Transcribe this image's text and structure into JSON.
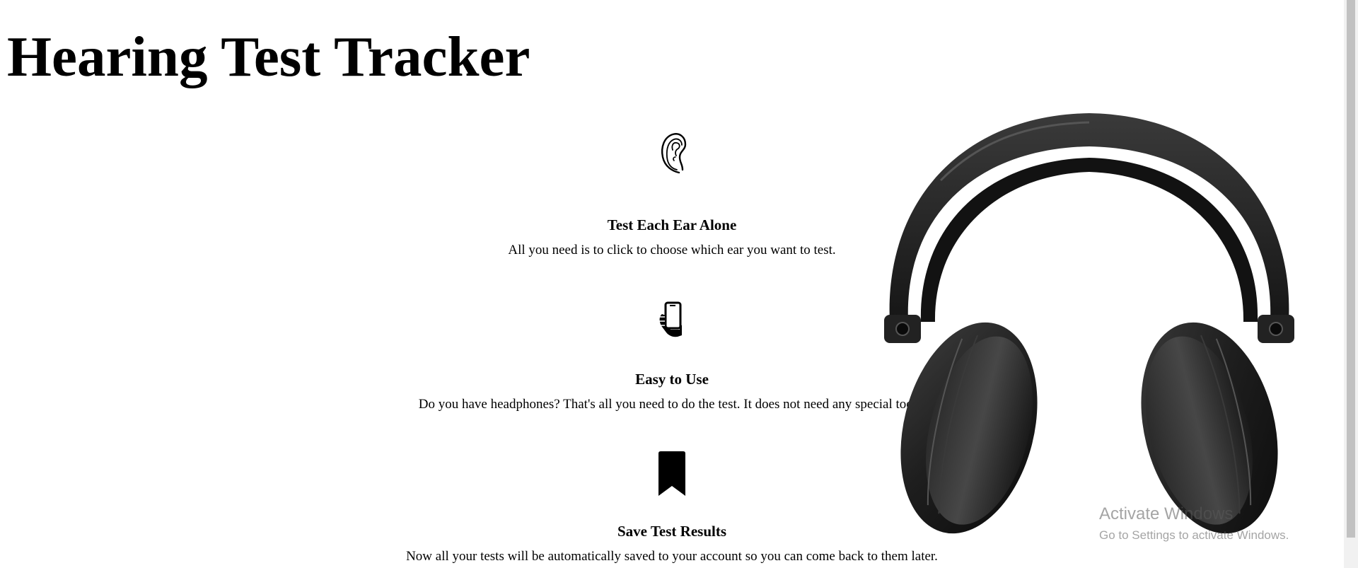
{
  "header": {
    "title": "Hearing Test Tracker"
  },
  "features": [
    {
      "icon": "ear-icon",
      "title": "Test Each Ear Alone",
      "description": "All you need is to click to choose which ear you want to test."
    },
    {
      "icon": "hand-phone-icon",
      "title": "Easy to Use",
      "description": "Do you have headphones? That's all you need to do the test. It does not need any special tools."
    },
    {
      "icon": "bookmark-icon",
      "title": "Save Test Results",
      "description": "Now all your tests will be automatically saved to your account so you can come back to them later."
    }
  ],
  "hero_image": {
    "icon": "headphones-image"
  },
  "watermark": {
    "title": "Activate Windows",
    "subtitle": "Go to Settings to activate Windows."
  }
}
